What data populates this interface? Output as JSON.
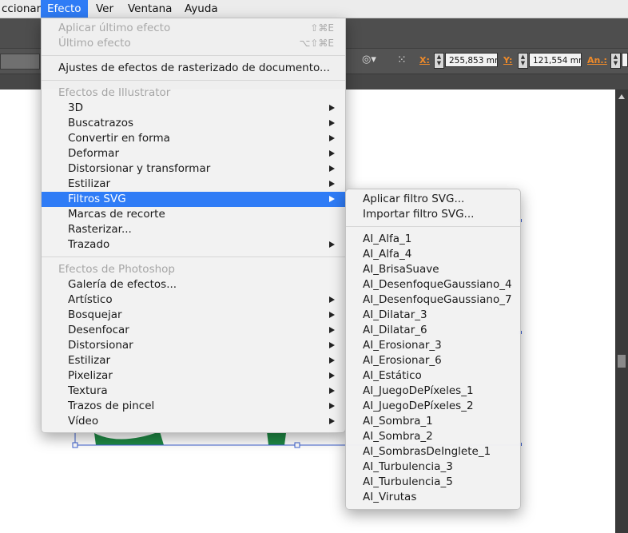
{
  "menubar": {
    "items": [
      "ccionar",
      "Efecto",
      "Ver",
      "Ventana",
      "Ayuda"
    ],
    "active_index": 1
  },
  "toolbar": {
    "x_label": "X:",
    "x_value": "255,853 mr",
    "y_label": "Y:",
    "y_value": "121,554 mr",
    "w_label": "An.:"
  },
  "efecto_menu": {
    "apply_last": "Aplicar último efecto",
    "apply_last_shortcut": "⇧⌘E",
    "last": "Último efecto",
    "last_shortcut": "⌥⇧⌘E",
    "raster_settings": "Ajustes de efectos de rasterizado de documento...",
    "illustrator_header": "Efectos de Illustrator",
    "illustrator_items": [
      "3D",
      "Buscatrazos",
      "Convertir en forma",
      "Deformar",
      "Distorsionar y transformar",
      "Estilizar",
      "Filtros SVG",
      "Marcas de recorte",
      "Rasterizar...",
      "Trazado"
    ],
    "photoshop_header": "Efectos de Photoshop",
    "photoshop_items": [
      "Galería de efectos...",
      "Artístico",
      "Bosquejar",
      "Desenfocar",
      "Distorsionar",
      "Estilizar",
      "Pixelizar",
      "Textura",
      "Trazos de pincel",
      "Vídeo"
    ]
  },
  "svg_submenu": {
    "apply": "Aplicar filtro SVG...",
    "import": "Importar filtro SVG...",
    "filters": [
      "AI_Alfa_1",
      "AI_Alfa_4",
      "AI_BrisaSuave",
      "AI_DesenfoqueGaussiano_4",
      "AI_DesenfoqueGaussiano_7",
      "AI_Dilatar_3",
      "AI_Dilatar_6",
      "AI_Erosionar_3",
      "AI_Erosionar_6",
      "AI_Estático",
      "AI_JuegoDePíxeles_1",
      "AI_JuegoDePíxeles_2",
      "AI_Sombra_1",
      "AI_Sombra_2",
      "AI_SombrasDeInglete_1",
      "AI_Turbulencia_3",
      "AI_Turbulencia_5",
      "AI_Virutas"
    ]
  },
  "colors": {
    "highlight": "#2f7cf6",
    "artwork_green": "#1f8a45",
    "selection_blue": "#3a5fd0",
    "label_orange": "#ee8a2a"
  }
}
